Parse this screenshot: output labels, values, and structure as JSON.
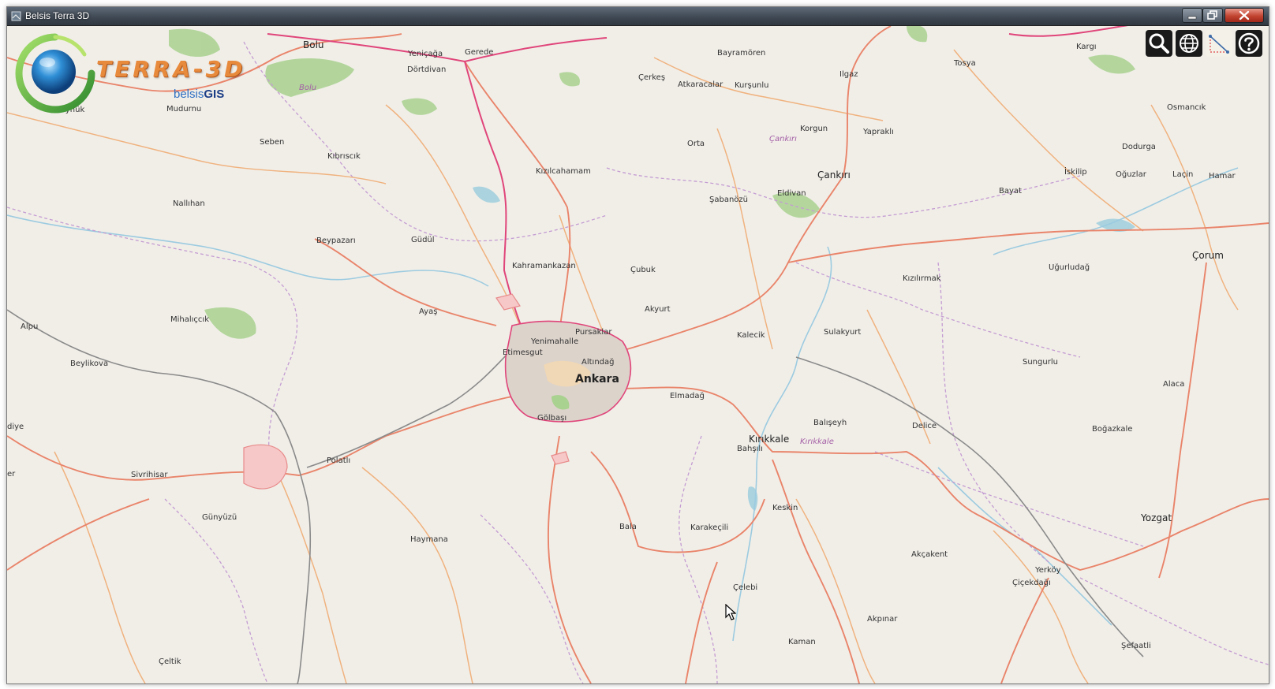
{
  "window": {
    "title": "Belsis Terra 3D",
    "controls": {
      "minimize": "minimize",
      "maximize": "maximize",
      "close": "close"
    }
  },
  "logo": {
    "wordmark": "TERRA-3D",
    "sub_prefix": "belsis",
    "sub_suffix": "GIS"
  },
  "toolbar": {
    "items": [
      {
        "id": "search",
        "icon": "search-icon"
      },
      {
        "id": "globe",
        "icon": "globe-icon"
      },
      {
        "id": "measure",
        "icon": "ruler-icon"
      },
      {
        "id": "help",
        "icon": "help-icon"
      }
    ]
  },
  "map": {
    "colors": {
      "land": "#f1eee8",
      "road_primary": "#e9846a",
      "road_secondary": "#f3b06c",
      "motorway": "#e0457a",
      "boundary": "#b88bc9",
      "water": "#aad3df",
      "forest": "#8dc56c",
      "urban": "#d9d0c9"
    },
    "labels": {
      "ankara": "Ankara",
      "kirikkale": "Kırıkkale",
      "kirikkale_prov": "Kırıkkale",
      "cankiri_prov": "Çankırı",
      "bolu_prov": "Bolu",
      "yozgat": "Yozgat",
      "corum": "Çorum",
      "cankiri": "Çankırı",
      "bolu": "Bolu",
      "gerede": "Gerede",
      "yenicaga": "Yeniçağa",
      "dortdivan": "Dörtdivan",
      "bayramoren": "Bayramören",
      "karg": "Kargı",
      "tosya": "Tosya",
      "ilgaz": "Ilgaz",
      "cerkes": "Çerkeş",
      "atkaracalar": "Atkaracalar",
      "kursunlu": "Kurşunlu",
      "osmancik": "Osmancık",
      "goynuk": "Göynük",
      "mudurnu": "Mudurnu",
      "seben": "Seben",
      "kibriscik": "Kıbrıscık",
      "kizilcahamam": "Kızılcahamam",
      "orta": "Orta",
      "korgun": "Korgun",
      "yaprakli": "Yapraklı",
      "dodurga": "Dodurga",
      "iskilip": "İskilip",
      "oguzlar": "Oğuzlar",
      "lacin": "Laçin",
      "hamar": "Hamar",
      "nallihan": "Nallıhan",
      "sabanozu": "Şabanözü",
      "eldivan": "Eldivan",
      "bayat": "Bayat",
      "beypazari": "Beypazarı",
      "gudul": "Güdül",
      "kahramankazan": "Kahramankazan",
      "cubuk": "Çubuk",
      "kizilirmak": "Kızılırmak",
      "ugurludag": "Uğurludağ",
      "ayas": "Ayaş",
      "akyurt": "Akyurt",
      "mihalgazi": "Mihalıçcık",
      "alpu": "Alpu",
      "beylikova": "Beylikova",
      "pursaklar": "Pursaklar",
      "kalecik": "Kalecik",
      "sulakyurt": "Sulakyurt",
      "yenimahalle": "Yenimahalle",
      "etimesgut": "Etimesgut",
      "altindag": "Altındağ",
      "sungurlu": "Sungurlu",
      "alaca": "Alaca",
      "elmadag": "Elmadağ",
      "golbasi": "Gölbaşı",
      "balisevh": "Balışeyh",
      "delice": "Delice",
      "bogazkale": "Boğazkale",
      "diye": "diye",
      "er": "er",
      "bahsili": "Bahşılı",
      "sivrihisar": "Sivrihisar",
      "polatli": "Polatlı",
      "keskin": "Keskin",
      "gunyuzu": "Günyüzü",
      "bala": "Bala",
      "karakecili": "Karakeçili",
      "haymana": "Haymana",
      "akcakent": "Akçakent",
      "yerkoy": "Yerköy",
      "cicekdagi": "Çiçekdağı",
      "celebi": "Çelebi",
      "akpinar": "Akpınar",
      "kaman": "Kaman",
      "sefaatli": "Şefaatli",
      "celtik": "Çeltik"
    }
  }
}
